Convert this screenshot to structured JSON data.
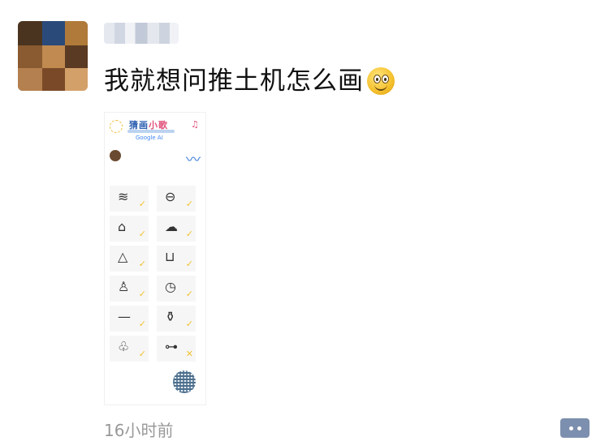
{
  "post": {
    "text": "我就想问推土机怎么画",
    "emoji": "smiling-face-emoji",
    "time": "16小时前"
  },
  "shared_image": {
    "app_title_part1": "猜画",
    "app_title_part2": "小歌",
    "powered_by": "Google AI",
    "cells": [
      {
        "sketch": "≋",
        "check": "✓"
      },
      {
        "sketch": "⊖",
        "check": "✓"
      },
      {
        "sketch": "⌂",
        "check": "✓"
      },
      {
        "sketch": "☁",
        "check": "✓"
      },
      {
        "sketch": "△",
        "check": "✓"
      },
      {
        "sketch": "⊔",
        "check": "✓"
      },
      {
        "sketch": "♙",
        "check": "✓"
      },
      {
        "sketch": "◷",
        "check": "✓"
      },
      {
        "sketch": "—",
        "check": "✓"
      },
      {
        "sketch": "⚱",
        "check": "✓"
      },
      {
        "sketch": "♧",
        "check": "✓"
      },
      {
        "sketch": "⊶",
        "check": "✕"
      }
    ]
  },
  "colors": {
    "check": "#f2c232",
    "title_blue": "#2c5fb0",
    "comment_button": "#7c8fae",
    "time_gray": "#999999"
  }
}
